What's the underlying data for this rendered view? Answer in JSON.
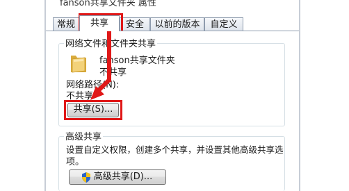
{
  "window": {
    "title": "fanson共享文件夹 属性"
  },
  "tabs": [
    {
      "label": "常规"
    },
    {
      "label": "共享"
    },
    {
      "label": "安全"
    },
    {
      "label": "以前的版本"
    },
    {
      "label": "自定义"
    }
  ],
  "network_sharing": {
    "group_title": "网络文件和文件夹共享",
    "folder_name": "fanson共享文件夹",
    "folder_status": "不共享",
    "path_label": "网络路径(N):",
    "path_value": "不共享",
    "share_button": "共享(S)..."
  },
  "advanced_sharing": {
    "group_title": "高级共享",
    "description_line1": "设置自定义权限，创建多个共享，并设置其他高级共享选",
    "description_line2": "项。",
    "button": "高级共享(D)..."
  },
  "colors": {
    "highlight": "#e01818",
    "folder": "#e8c35a",
    "shield_blue": "#2a64c9",
    "shield_yellow": "#f2c21b"
  },
  "icons": {
    "folder": "folder-icon",
    "shield": "uac-shield-icon",
    "arrow": "red-arrow-annotation"
  }
}
